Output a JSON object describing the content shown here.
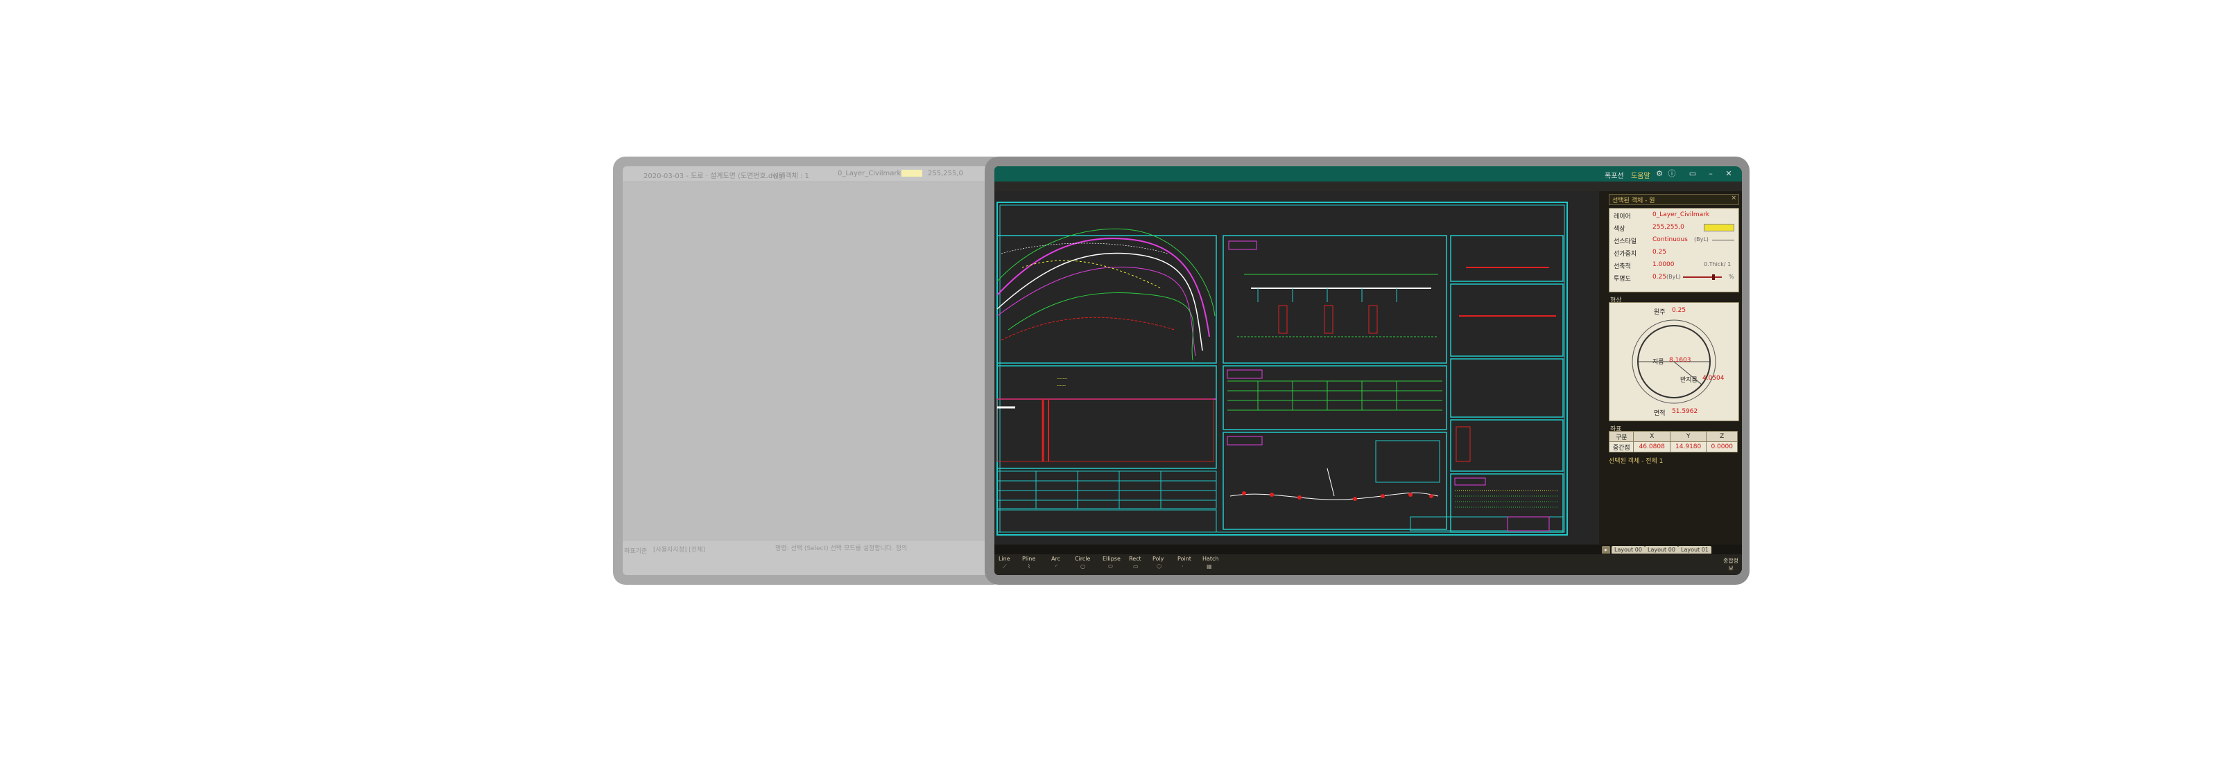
{
  "left_window": {
    "title_text": "2020-03-03 - 도로 · 설계도면 (도면번호.dwg)",
    "selection": "선택객체 : 1",
    "layer": "0_Layer_Civilmark",
    "color_value": "255,255,0",
    "bottom_text_1": "명령: 선택 (Select) 선택 모드를 설정합니다. 정의",
    "bottom_text_2": "[사용자지정] [전체]",
    "bottom_left_label": "좌표기준"
  },
  "title_bar": {
    "label_1": "폭포선",
    "label_2": "도움말"
  },
  "properties": {
    "header": "선택된 객체 - 원",
    "rows": [
      {
        "label": "레이어",
        "value": "0_Layer_Civilmark"
      },
      {
        "label": "색상",
        "value": "255,255,0"
      },
      {
        "label": "선스타일",
        "value": "Continuous",
        "sub": "(ByL)"
      },
      {
        "label": "선가중치",
        "value": "0.25"
      },
      {
        "label": "선축척",
        "value": "1.0000",
        "sub": "0.Thick/ 1"
      },
      {
        "label": "투명도",
        "value": "0.25",
        "sub": "(ByL)",
        "unit": "%"
      }
    ],
    "shape_title": "형상",
    "shape": {
      "perimeter_label": "원주",
      "perimeter_value": "0.25",
      "diameter_label": "지름",
      "diameter_value": "8.1603",
      "radius_label": "반지름",
      "radius_value": "4.0504",
      "area_label": "면적",
      "area_value": "51.5962"
    },
    "coord_title": "좌표",
    "coord_headers": [
      "구분",
      "X",
      "Y",
      "Z"
    ],
    "coord_row": {
      "label": "중간점",
      "x": "46.0808",
      "y": "14.9180",
      "z": "0.0000"
    },
    "selection_footer": "선택된 객체 - 전체 1"
  },
  "tabs": [
    "Layout 00",
    "Layout 00",
    "Layout 01"
  ],
  "draw_tools": [
    "Line",
    "Pline",
    "Arc",
    "Circle",
    "Ellipse",
    "Rect",
    "Poly",
    "Point",
    "Hatch"
  ],
  "status_right": "종합정보",
  "colors": {
    "title_bar": "#0e5e52",
    "cad_cyan": "#22c8c8",
    "cad_green": "#2ecc40",
    "cad_magenta": "#e040e0",
    "cad_red": "#e02020",
    "cad_yellow": "#f0f040",
    "swatch": "#f0e030"
  }
}
